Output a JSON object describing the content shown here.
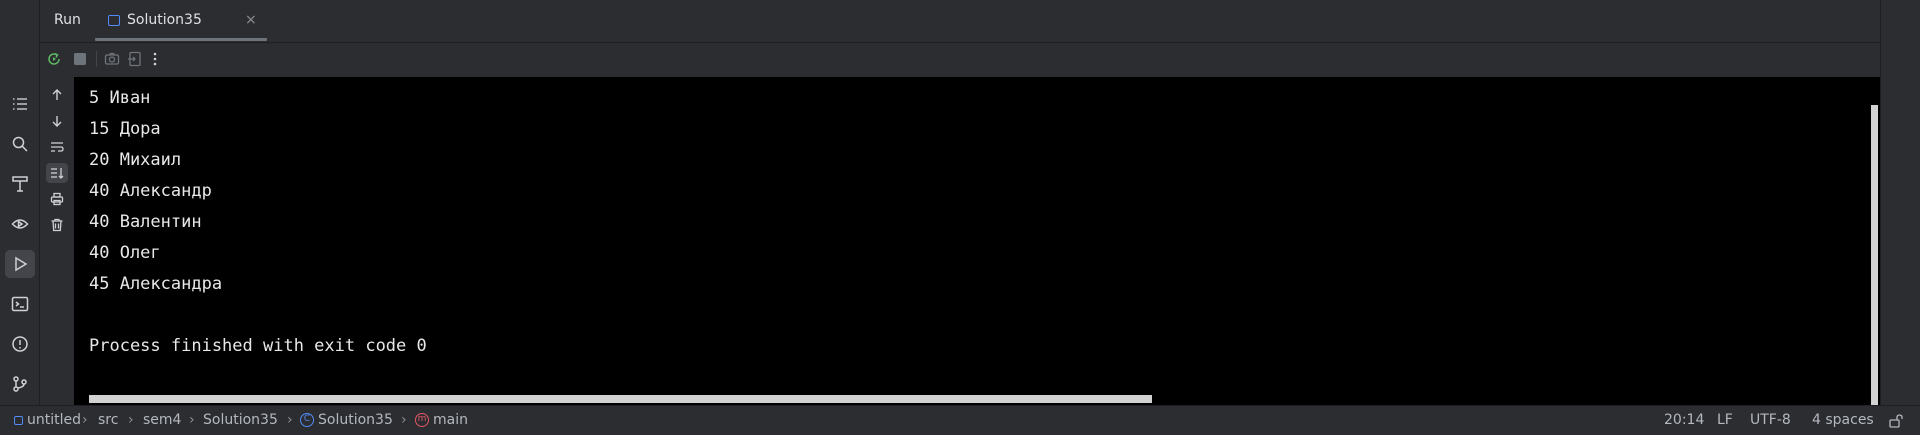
{
  "header": {
    "run_title": "Run",
    "tab_label": "Solution35",
    "tab_close": "×"
  },
  "icons": {
    "left_strip": [
      "structure-icon",
      "search-icon",
      "build-icon",
      "services-icon",
      "run-icon",
      "terminal-icon",
      "problems-icon",
      "git-icon"
    ],
    "toolbar": [
      "rerun-icon",
      "stop-icon",
      "camera-icon",
      "export-icon",
      "more-icon"
    ],
    "gutter": [
      "arrow-up-icon",
      "arrow-down-icon",
      "soft-wrap-icon",
      "scroll-to-end-icon",
      "print-icon",
      "trash-icon"
    ]
  },
  "console": {
    "lines": [
      "5 Иван",
      "15 Дора",
      "20 Михаил",
      "40 Александр",
      "40 Валентин",
      "40 Олег",
      "45 Александра",
      "",
      "Process finished with exit code 0"
    ]
  },
  "breadcrumb": {
    "project": "untitled",
    "src": "src",
    "package": "sem4",
    "file": "Solution35",
    "class": "Solution35",
    "method": "main",
    "class_icon_letter": "C",
    "method_icon_letter": "m"
  },
  "status": {
    "position": "20:14",
    "line_separator": "LF",
    "encoding": "UTF-8",
    "indent": "4 spaces"
  },
  "colors": {
    "panel": "#2b2d30",
    "console_bg": "#000000",
    "accent": "#548af7",
    "rerun": "#5fb865",
    "method": "#e55765"
  }
}
